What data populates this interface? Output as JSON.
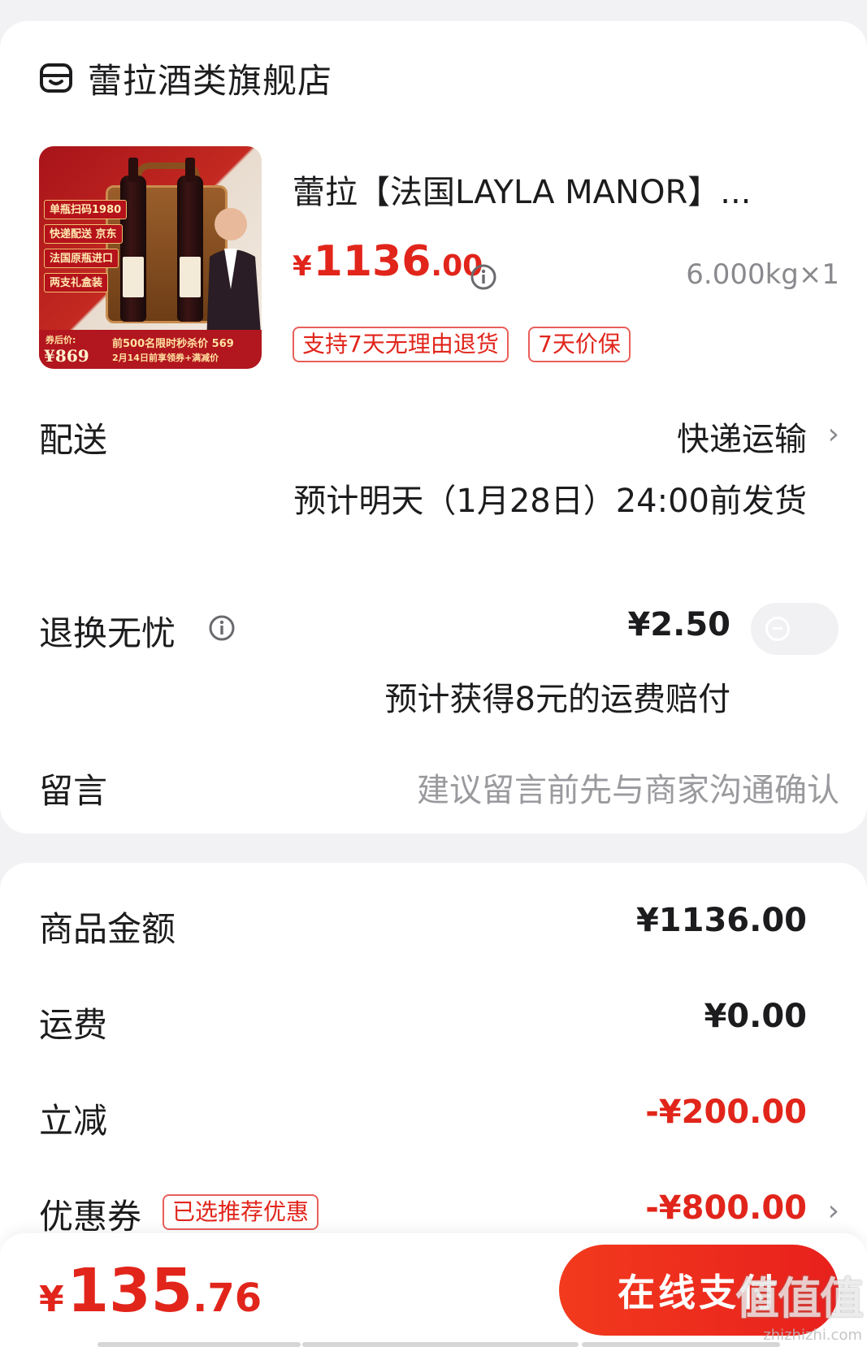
{
  "shop": {
    "name": "蕾拉酒类旗舰店",
    "icon": "store-icon"
  },
  "product": {
    "title": "蕾拉【法国LAYLA MANOR】...",
    "price_currency": "¥",
    "price_int": "1136",
    "price_dec": ".00",
    "weight_qty": "6.000kg×1",
    "badges": [
      "支持7天无理由退货",
      "7天价保"
    ],
    "image": {
      "tags": [
        "单瓶扫码1980",
        "快递配送 京东",
        "法国原瓶进口",
        "两支礼盒装"
      ],
      "after_coupon_label": "券后价:",
      "after_coupon_price": "¥869",
      "banner_line1": "前500名限时秒杀价 569",
      "banner_line2": "2月14日前享领券+满减价"
    }
  },
  "delivery": {
    "label": "配送",
    "method": "快递运输",
    "estimate": "预计明天（1月28日）24:00前发货"
  },
  "return_insurance": {
    "label": "退换无忧",
    "price": "¥2.50",
    "note": "预计获得8元的运费赔付",
    "enabled": false
  },
  "message": {
    "label": "留言",
    "placeholder": "建议留言前先与商家沟通确认"
  },
  "summary": {
    "goods_label": "商品金额",
    "goods_value": "¥1136.00",
    "shipping_label": "运费",
    "shipping_value": "¥0.00",
    "discount_label": "立减",
    "discount_value": "-¥200.00",
    "coupon_label": "优惠券",
    "coupon_tag": "已选推荐优惠",
    "coupon_value": "-¥800.00"
  },
  "bottom": {
    "total_currency": "¥",
    "total_int": "135",
    "total_dec": ".76",
    "pay_label": "在线支付"
  },
  "watermark": {
    "text": "值值值",
    "url": "zhizhizhi.com"
  },
  "colors": {
    "accent": "#e1251b",
    "muted": "#9a9a9e",
    "background": "#f2f2f4"
  }
}
